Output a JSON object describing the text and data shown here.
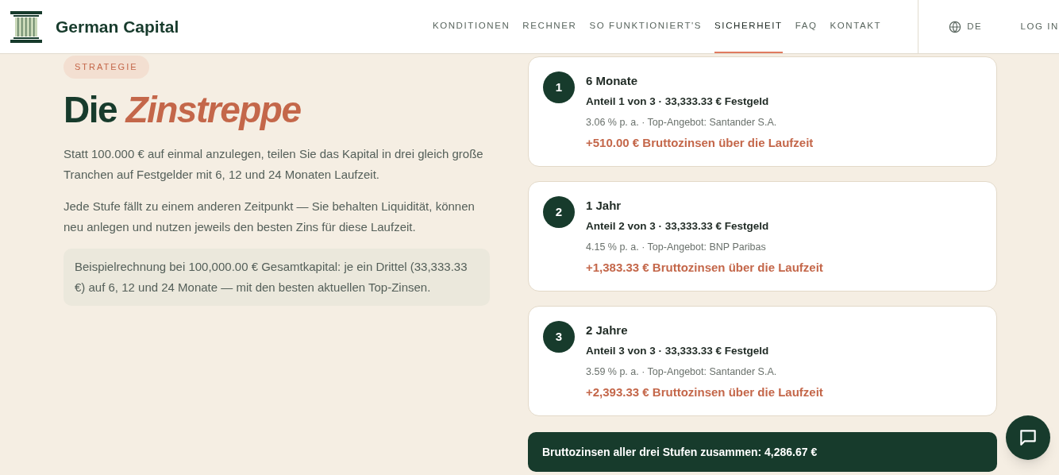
{
  "header": {
    "brand": "German Capital",
    "nav": [
      {
        "label": "KONDITIONEN",
        "selected": false
      },
      {
        "label": "RECHNER",
        "selected": false
      },
      {
        "label": "SO FUNKTIONIERT'S",
        "selected": false
      },
      {
        "label": "SICHERHEIT",
        "selected": true
      },
      {
        "label": "FAQ",
        "selected": false
      },
      {
        "label": "KONTAKT",
        "selected": false
      }
    ],
    "language": "DE",
    "login": "LOG IN"
  },
  "intro": {
    "badge": "STRATEGIE",
    "title": "Die *Zinstreppe*",
    "paragraphs": [
      "Statt 100.000 € auf einmal anzulegen, teilen Sie das Kapital in drei gleich große Tranchen auf Festgelder mit 6, 12 und 24 Monaten Laufzeit.",
      "Jede Stufe fällt zu einem anderen Zeitpunkt — Sie behalten Liquidität, können neu anlegen und nutzen jeweils den besten Zins für diese Laufzeit."
    ],
    "example": "Beispielrechnung bei 100,000.00 € Gesamtkapital: je ein Drittel (33,333.33 €) auf 6, 12 und 24 Monate — mit den besten aktuellen Top-Zinsen."
  },
  "steps": [
    {
      "number": "1",
      "term": "6 Monate",
      "share": "Anteil 1 von 3 · 33,333.33 € Festgeld",
      "offer": "3.06 % p. a. · Top-Angebot: Santander S.A.",
      "interest": "+510.00 € Bruttozinsen über die Laufzeit"
    },
    {
      "number": "2",
      "term": "1 Jahr",
      "share": "Anteil 2 von 3 · 33,333.33 € Festgeld",
      "offer": "4.15 % p. a. · Top-Angebot: BNP Paribas",
      "interest": "+1,383.33 € Bruttozinsen über die Laufzeit"
    },
    {
      "number": "3",
      "term": "2 Jahre",
      "share": "Anteil 3 von 3 · 33,333.33 € Festgeld",
      "offer": "3.59 % p. a. · Top-Angebot: Santander S.A.",
      "interest": "+2,393.33 € Bruttozinsen über die Laufzeit"
    }
  ],
  "total": "Bruttozinsen aller drei Stufen zusammen: 4,286.67 €"
}
